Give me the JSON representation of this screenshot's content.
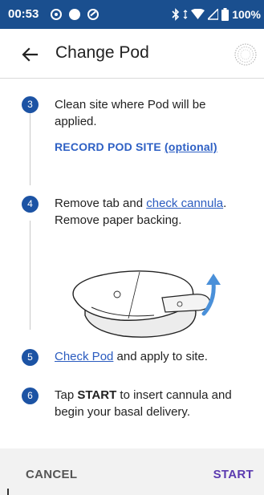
{
  "status_bar": {
    "time": "00:53",
    "battery_text": "100%",
    "left_icons": [
      "radio-button-icon",
      "circle-icon",
      "do-not-disturb-icon"
    ],
    "right_icons": [
      "bluetooth-icon",
      "data-arrows-icon",
      "wifi-icon",
      "cellular-signal-icon",
      "battery-icon"
    ]
  },
  "header": {
    "title": "Change Pod",
    "back_icon": "arrow-back-icon",
    "right_icon": "pod-icon"
  },
  "steps": [
    {
      "number": "3",
      "text": "Clean site where Pod will be applied."
    },
    {
      "number": "4",
      "link": "check cannula",
      "text_before": "Remove tab and ",
      "text_after": ".",
      "text_line2": "Remove paper backing."
    },
    {
      "number": "5",
      "link": "Check Pod",
      "text_after": " and apply to site."
    },
    {
      "number": "6",
      "text_before": "Tap ",
      "bold": "START",
      "text_after": " to insert cannula and begin your basal delivery."
    }
  ],
  "record_link": {
    "label": "RECORD POD SITE",
    "optional": "(optional)"
  },
  "footer": {
    "cancel_label": "CANCEL",
    "start_label": "START"
  },
  "colors": {
    "status_bar": "#1a4f8f",
    "step_badge": "#1c53a4",
    "link": "#2a5bbf",
    "start": "#5b3ab0",
    "footer_bg": "#f2f2f2"
  }
}
